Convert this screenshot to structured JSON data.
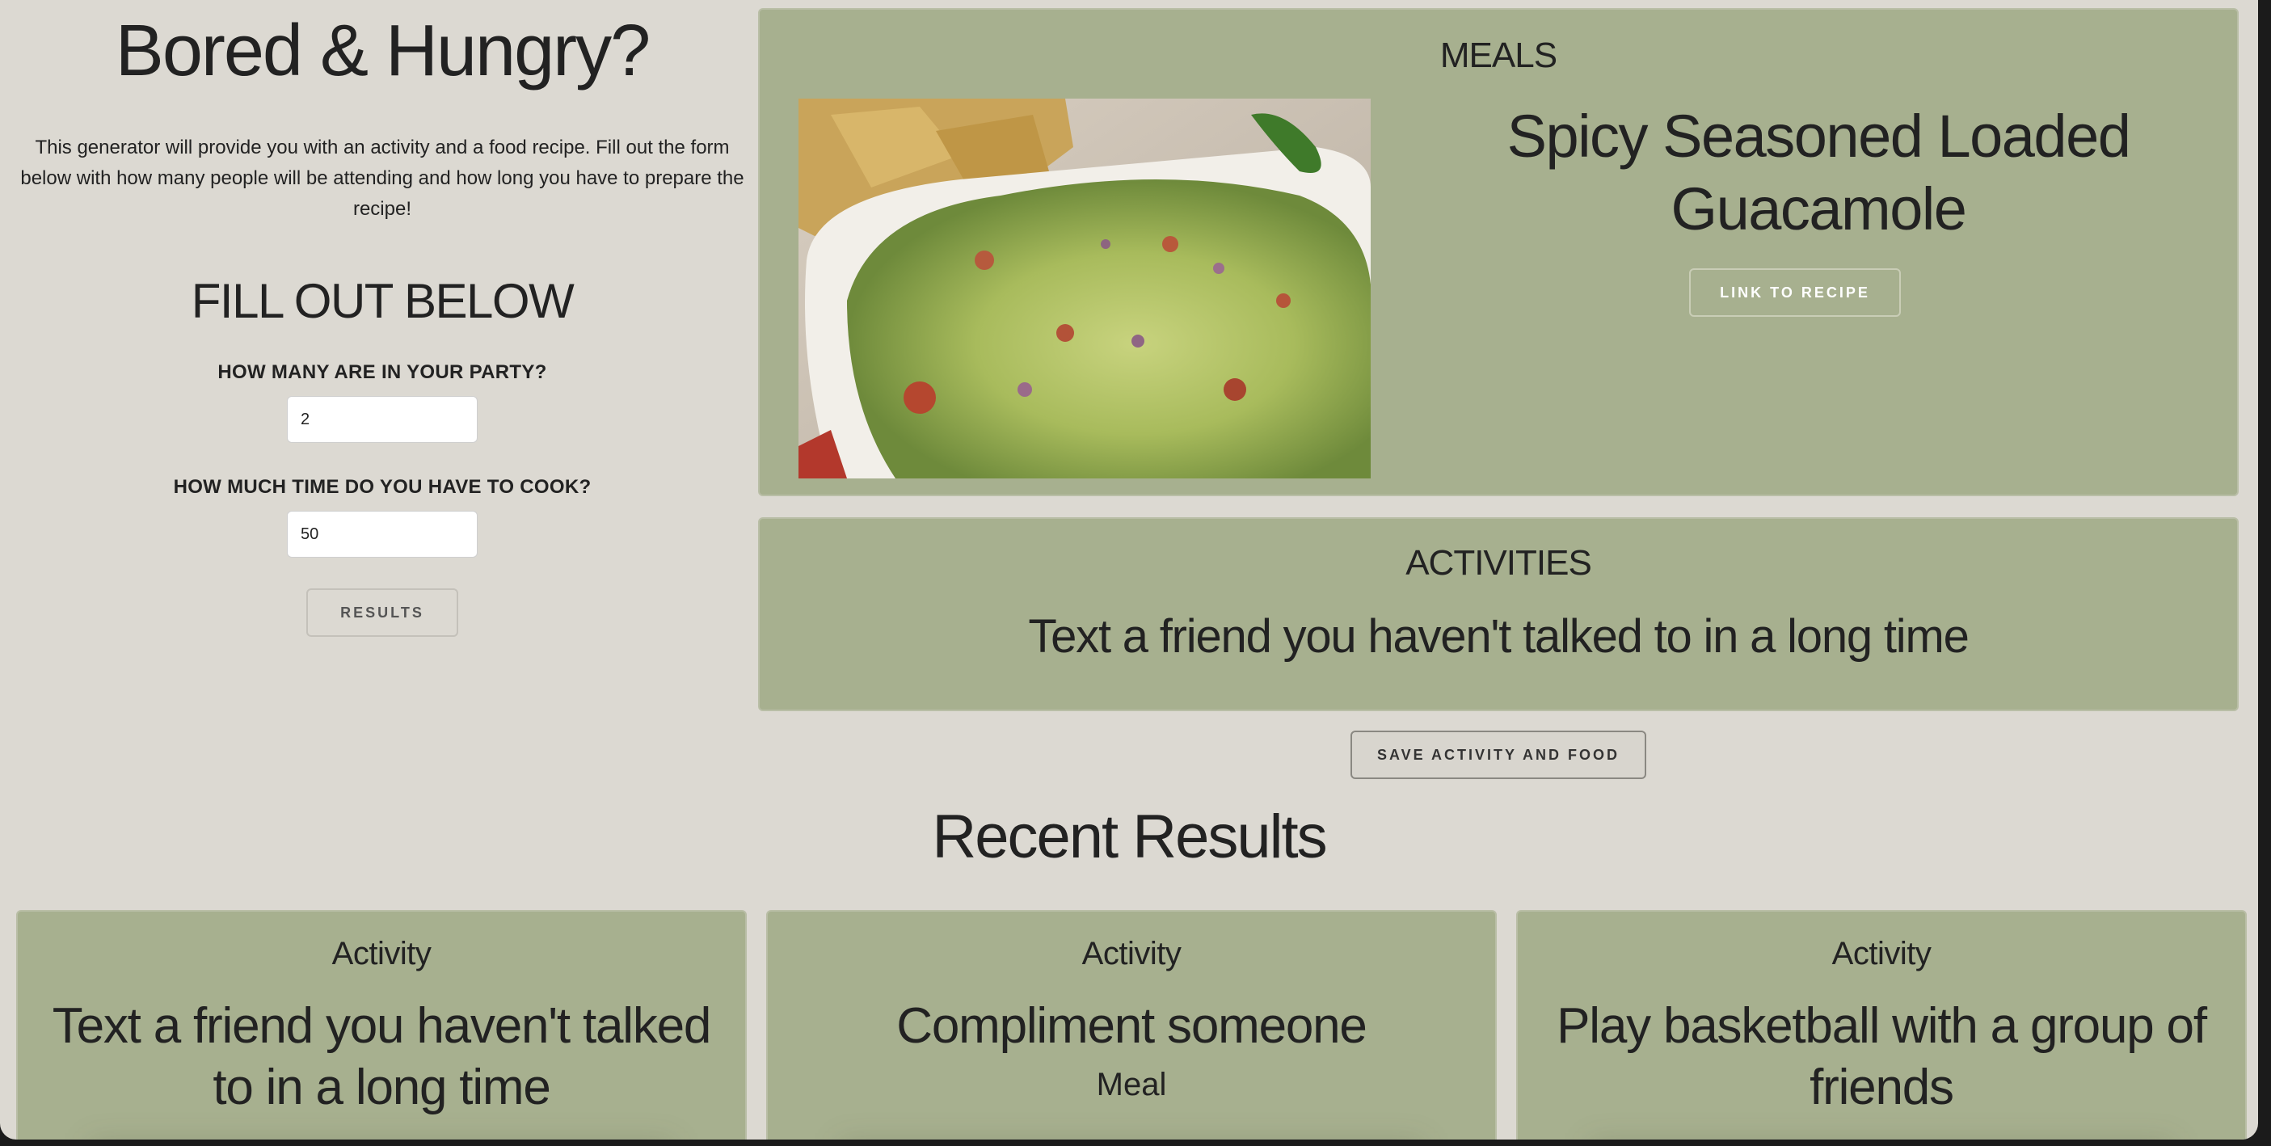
{
  "header": {
    "title": "Bored & Hungry?",
    "intro": "This generator will provide you with an activity and a food recipe. Fill out the form below with how many people will be attending and how long you have to prepare the recipe!"
  },
  "form": {
    "heading": "FILL OUT BELOW",
    "party_label": "HOW MANY ARE IN YOUR PARTY?",
    "party_value": "2",
    "time_label": "HOW MUCH TIME DO YOU HAVE TO COOK?",
    "time_value": "50",
    "results_button": "RESULTS"
  },
  "meals": {
    "heading": "MEALS",
    "title": "Spicy Seasoned Loaded Guacamole",
    "link_button": "LINK TO RECIPE",
    "image_icon": "guacamole-photo"
  },
  "activities": {
    "heading": "ACTIVITIES",
    "text": "Text a friend you haven't talked to in a long time"
  },
  "save_button": "SAVE ACTIVITY AND FOOD",
  "recent": {
    "title": "Recent Results",
    "cards": [
      {
        "label": "Activity",
        "text": "Text a friend you haven't talked to in a long time",
        "meal_label": ""
      },
      {
        "label": "Activity",
        "text": "Compliment someone",
        "meal_label": "Meal"
      },
      {
        "label": "Activity",
        "text": "Play basketball with a group of friends",
        "meal_label": ""
      }
    ]
  },
  "colors": {
    "page_bg": "#dcd9d2",
    "panel_bg": "#a7b08f",
    "text": "#222222"
  }
}
